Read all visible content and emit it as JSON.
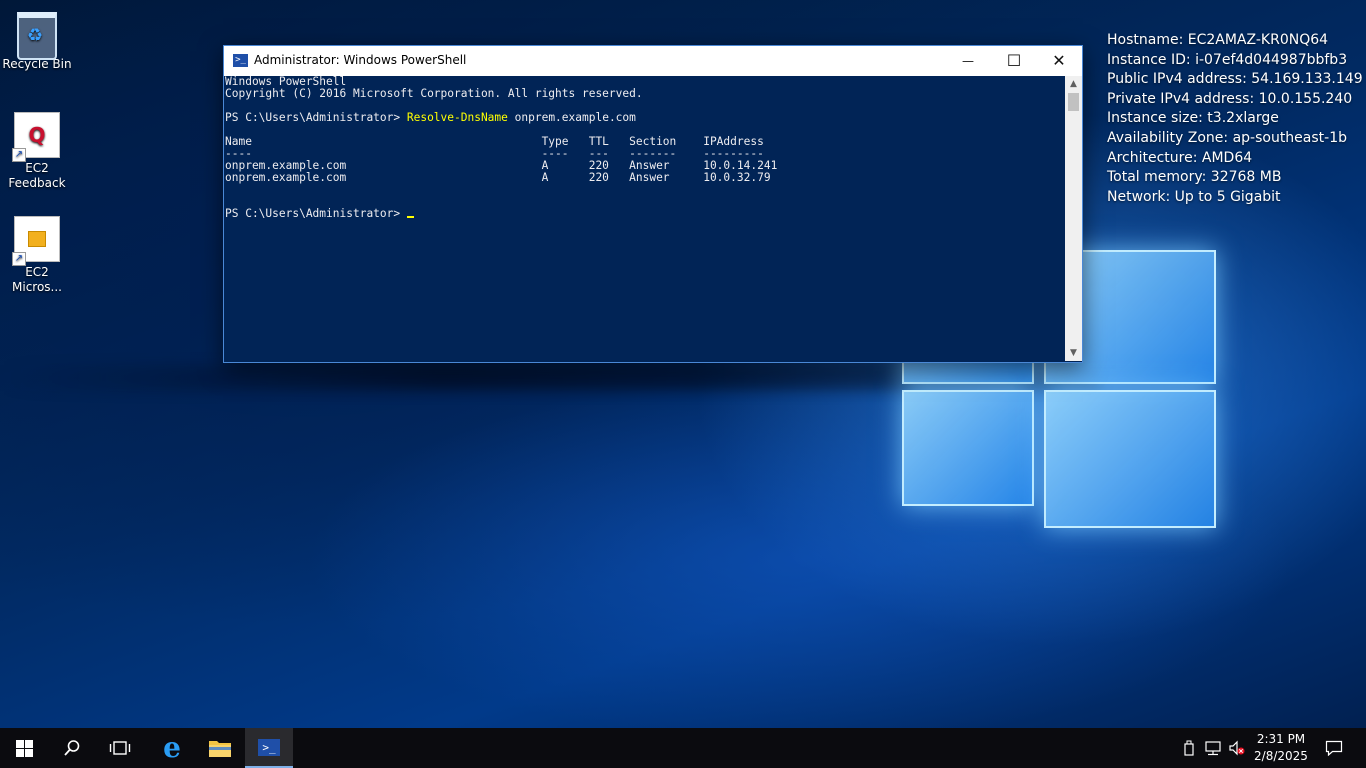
{
  "desktop": {
    "icons": [
      {
        "label": "Recycle Bin"
      },
      {
        "label": "EC2\nFeedback"
      },
      {
        "label": "EC2\nMicros..."
      }
    ]
  },
  "info_panel": {
    "lines": [
      "Hostname: EC2AMAZ-KR0NQ64",
      "Instance ID: i-07ef4d044987bbfb3",
      "Public IPv4 address: 54.169.133.149",
      "Private IPv4 address: 10.0.155.240",
      "Instance size: t3.2xlarge",
      "Availability Zone: ap-southeast-1b",
      "Architecture: AMD64",
      "Total memory: 32768 MB",
      "Network: Up to 5 Gigabit"
    ]
  },
  "window": {
    "title": "Administrator: Windows PowerShell",
    "minimize": "—",
    "maximize": "☐",
    "close": "✕"
  },
  "console": {
    "banner1": "Windows PowerShell",
    "banner2": "Copyright (C) 2016 Microsoft Corporation. All rights reserved.",
    "prompt1": "PS C:\\Users\\Administrator> ",
    "command": "Resolve-DnsName",
    "args": " onprem.example.com",
    "header": "Name                                           Type   TTL   Section    IPAddress",
    "underline": "----                                           ----   ---   -------    ---------",
    "rows": [
      "onprem.example.com                             A      220   Answer     10.0.14.241",
      "onprem.example.com                             A      220   Answer     10.0.32.79"
    ],
    "prompt2": "PS C:\\Users\\Administrator> "
  },
  "taskbar": {
    "clock_time": "2:31 PM",
    "clock_date": "2/8/2025"
  },
  "colors": {
    "console_bg": "#012456",
    "console_text": "#eeedf0",
    "command_yellow": "#ffff00",
    "taskbar_bg": "#0b0b0f"
  }
}
